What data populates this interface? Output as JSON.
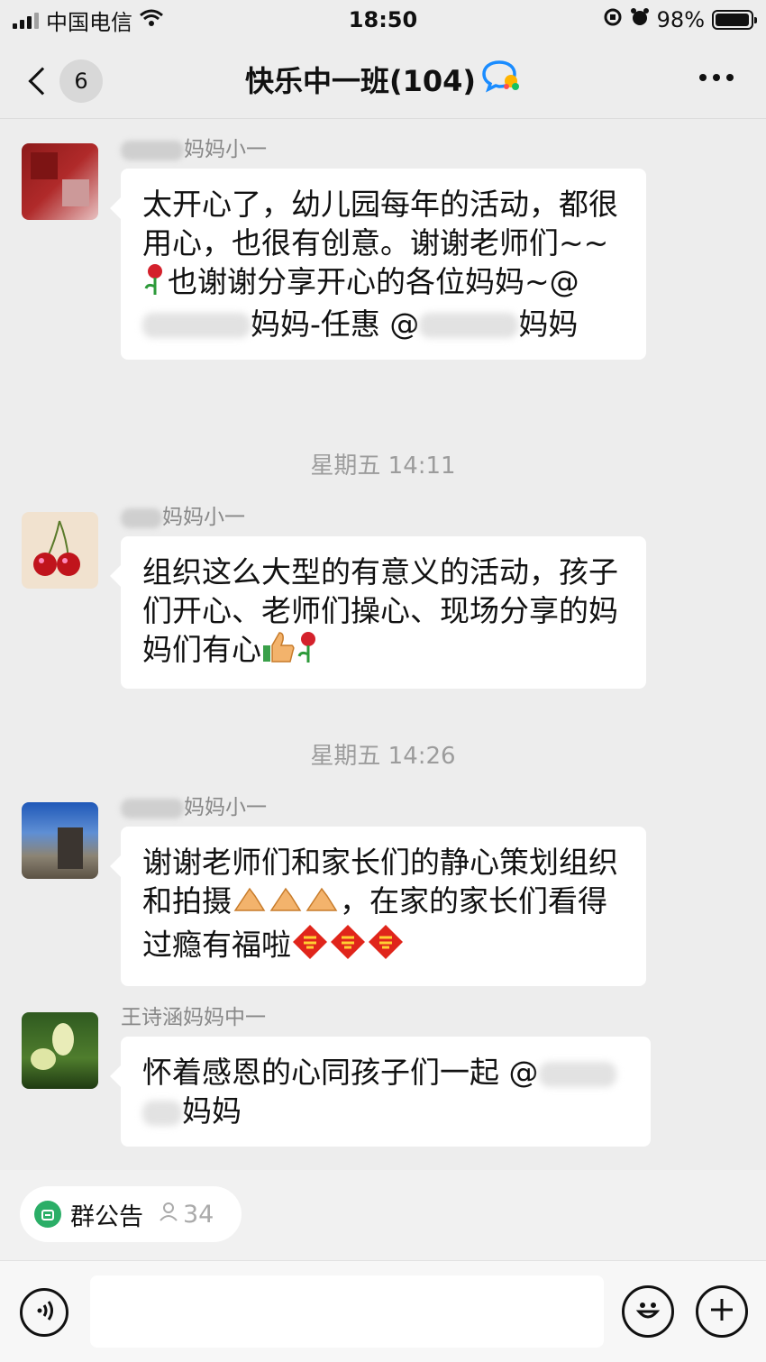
{
  "status": {
    "carrier": "中国电信",
    "time": "18:50",
    "battery": "98%",
    "battery_level": 0.98
  },
  "nav": {
    "unread": "6",
    "title": "快乐中一班(104)"
  },
  "messages": [
    {
      "sender_visible": "妈妈小一",
      "text_parts": [
        "太开心了，幼儿园每年的活动，都很用心，也很有创意。谢谢老师们~~",
        "也谢谢分享开心的各位妈妈~@",
        "妈妈-任惠 @",
        "妈妈"
      ]
    },
    {
      "sender_visible": "妈妈小一",
      "text_parts": [
        "组织这么大型的有意义的活动，孩子们开心、老师们操心、现场分享的妈妈们有心"
      ]
    },
    {
      "sender_visible": "妈妈小一",
      "text_parts": [
        "谢谢老师们和家长们的静心策划组织和拍摄",
        "，在家的家长们看得过瘾有福啦"
      ]
    },
    {
      "sender": "王诗涵妈妈中一",
      "text_parts": [
        "怀着感恩的心同孩子们一起 @",
        "妈妈"
      ]
    }
  ],
  "timestamps": [
    "星期五 14:11",
    "星期五 14:26"
  ],
  "notice": {
    "label": "群公告",
    "count": "34"
  },
  "input": {
    "value": ""
  }
}
